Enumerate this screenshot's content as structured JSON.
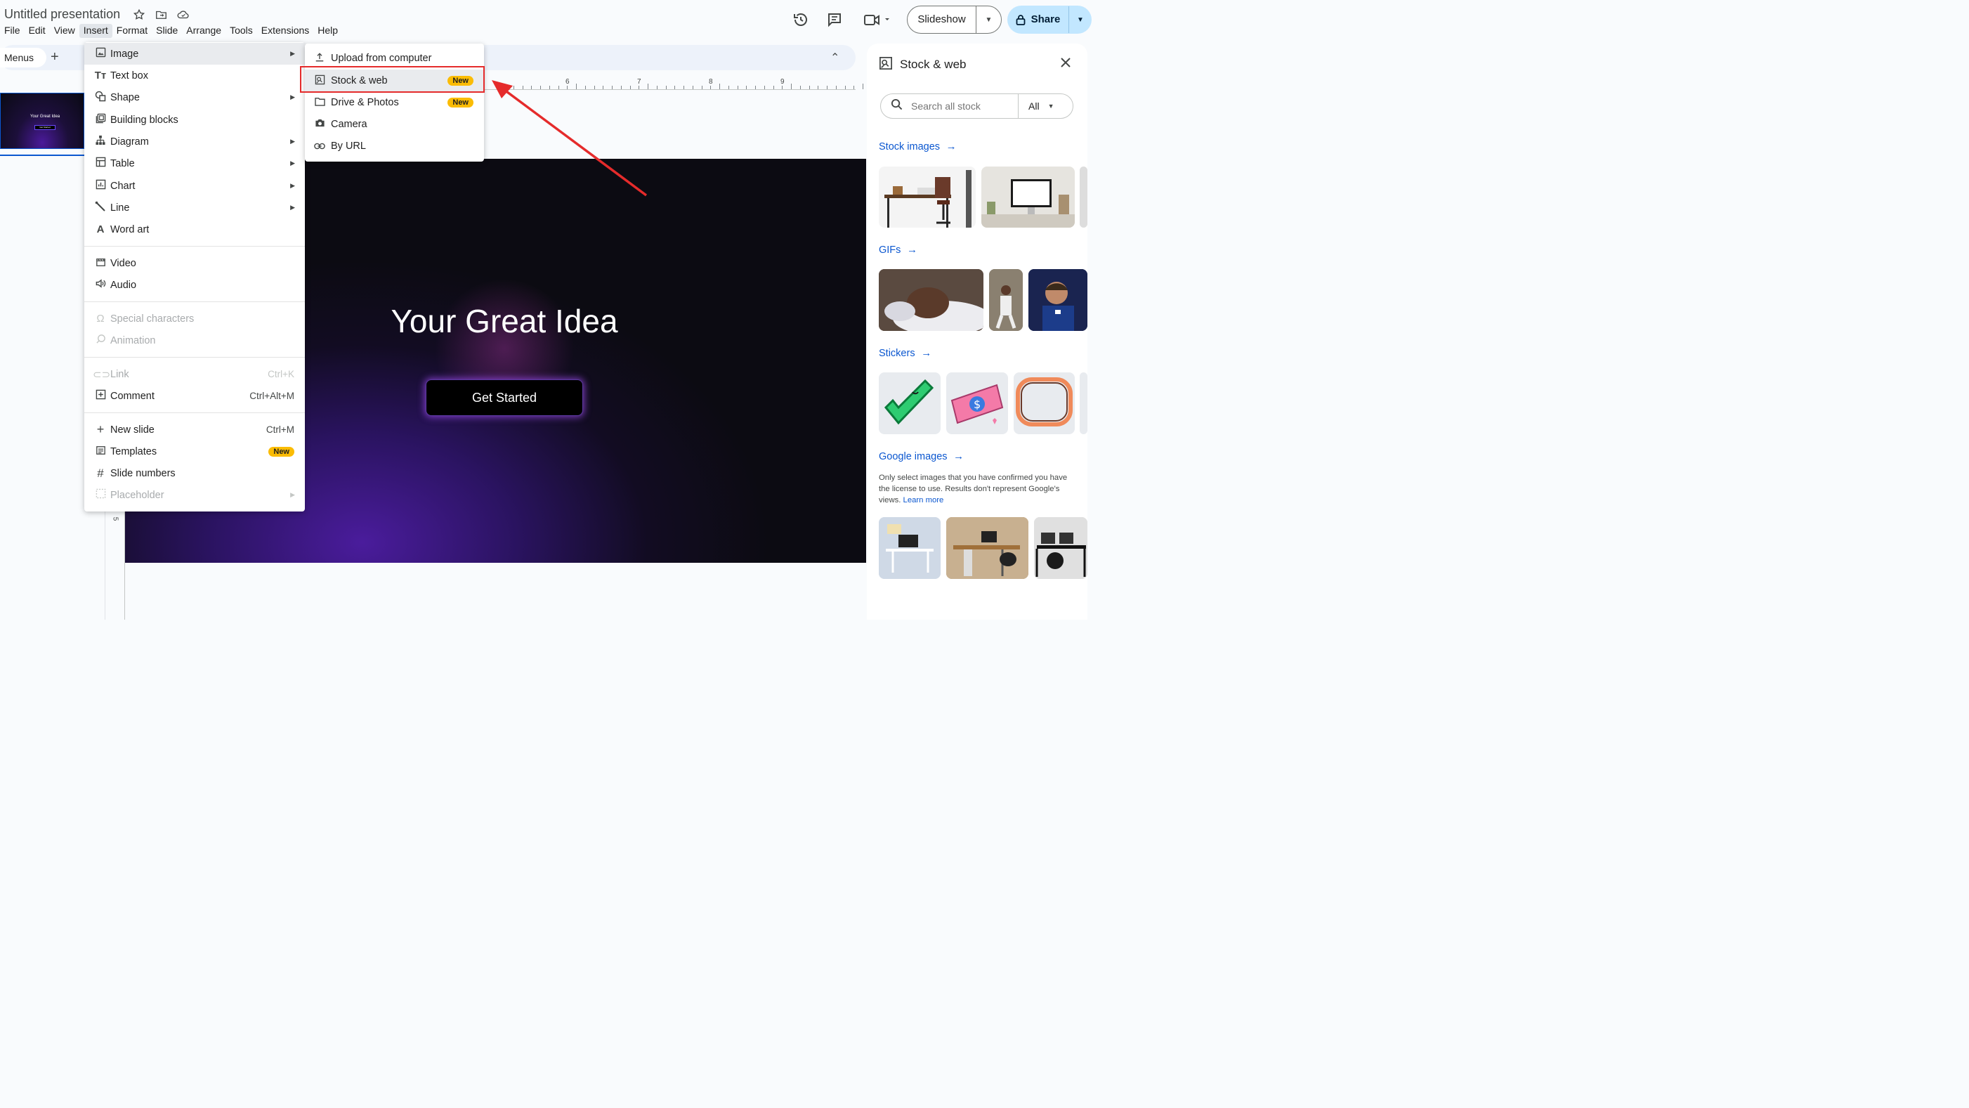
{
  "app": {
    "doc_title": "Untitled presentation",
    "menu": [
      "File",
      "Edit",
      "View",
      "Insert",
      "Format",
      "Slide",
      "Arrange",
      "Tools",
      "Extensions",
      "Help"
    ],
    "slideshow_label": "Slideshow",
    "share_label": "Share",
    "menus_chip": "Menus"
  },
  "ruler": {
    "h_numbers": [
      "6",
      "7",
      "8",
      "9"
    ],
    "v_number": "5"
  },
  "slide": {
    "title": "Your Great Idea",
    "button": "Get Started",
    "thumb_title": "Your Great Idea",
    "thumb_button": "Get Started"
  },
  "insert_menu": {
    "image": "Image",
    "text_box": "Text box",
    "shape": "Shape",
    "building_blocks": "Building blocks",
    "diagram": "Diagram",
    "table": "Table",
    "chart": "Chart",
    "line": "Line",
    "word_art": "Word art",
    "video": "Video",
    "audio": "Audio",
    "special_characters": "Special characters",
    "animation": "Animation",
    "link": "Link",
    "link_shortcut": "Ctrl+K",
    "comment": "Comment",
    "comment_shortcut": "Ctrl+Alt+M",
    "new_slide": "New slide",
    "new_slide_shortcut": "Ctrl+M",
    "templates": "Templates",
    "templates_badge": "New",
    "slide_numbers": "Slide numbers",
    "placeholder": "Placeholder"
  },
  "image_submenu": {
    "upload": "Upload from computer",
    "stock_web": "Stock & web",
    "stock_web_badge": "New",
    "drive_photos": "Drive & Photos",
    "drive_photos_badge": "New",
    "camera": "Camera",
    "by_url": "By URL"
  },
  "side_panel": {
    "title": "Stock & web",
    "search_placeholder": "Search all stock",
    "filter": "All",
    "stock_images": "Stock images",
    "gifs": "GIFs",
    "stickers": "Stickers",
    "google_images": "Google images",
    "disclaimer": "Only select images that you have confirmed you have the license to use. Results don't represent Google's views.",
    "learn_more": "Learn more"
  },
  "colors": {
    "accent": "#0b57d0",
    "share_bg": "#c2e7ff",
    "badge": "#fbbc04",
    "annotation_red": "#e52b2b",
    "slide_bg": "#120c22"
  },
  "icons": {
    "title_row": [
      "star-icon",
      "move-to-folder-icon",
      "cloud-saved-icon"
    ],
    "top_right": [
      "version-history-icon",
      "comments-icon",
      "meet-icon"
    ],
    "share": "lock-icon"
  }
}
